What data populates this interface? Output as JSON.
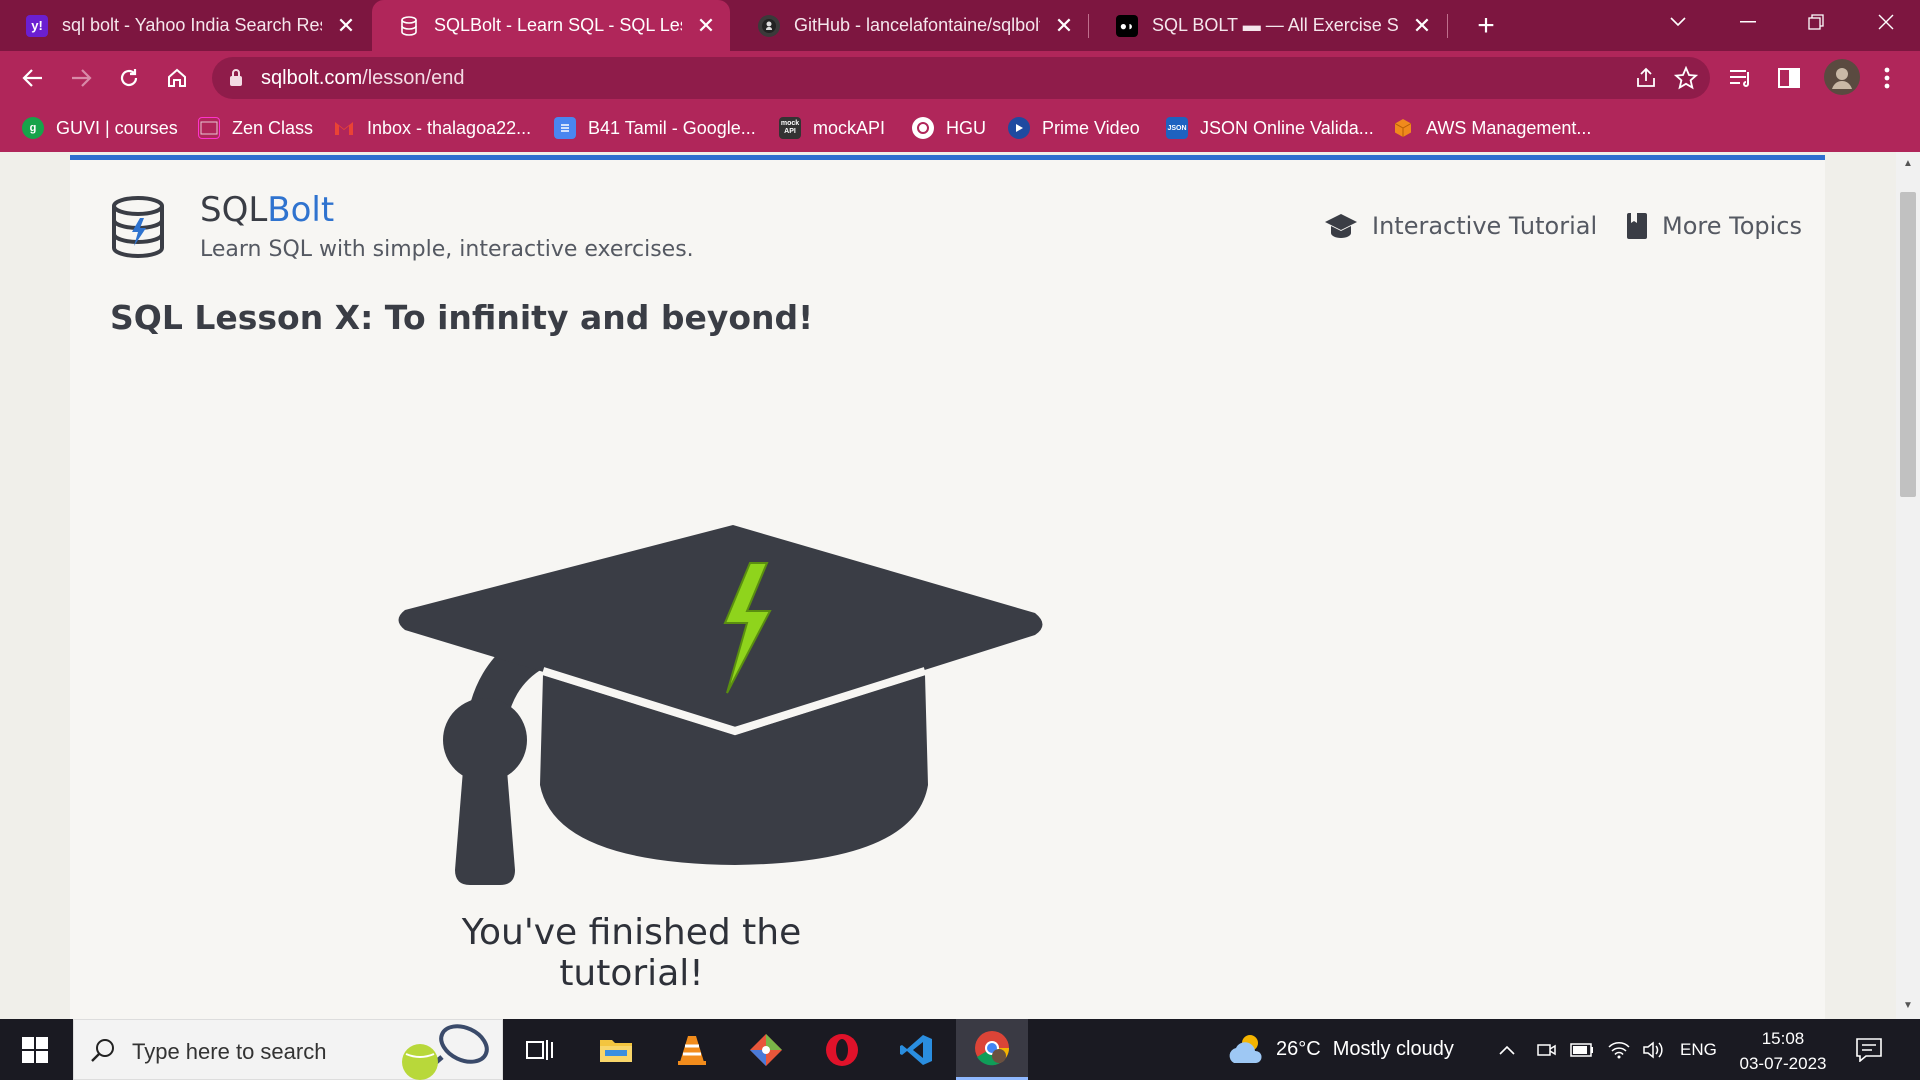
{
  "browser": {
    "tabs": [
      {
        "title": "sql bolt - Yahoo India Search Resu",
        "favicon": "y!",
        "active": false
      },
      {
        "title": "SQLBolt - Learn SQL - SQL Lesson",
        "favicon": "db",
        "active": true
      },
      {
        "title": "GitHub - lancelafontaine/sqlbolt-",
        "favicon": "gh",
        "active": false
      },
      {
        "title": "SQL BOLT ▬ — All Exercise Soluti",
        "favicon": "M",
        "active": false
      }
    ],
    "new_tab_label": "+",
    "address": {
      "host": "sqlbolt.com",
      "path": "/lesson/end"
    },
    "bookmarks": [
      {
        "label": "GUVI | courses",
        "icon": "g"
      },
      {
        "label": "Zen Class",
        "icon": "zen"
      },
      {
        "label": "Inbox - thalagoa22...",
        "icon": "M"
      },
      {
        "label": "B41 Tamil - Google...",
        "icon": "doc"
      },
      {
        "label": "mockAPI",
        "icon": "mock API"
      },
      {
        "label": "HGU",
        "icon": "hgu"
      },
      {
        "label": "Prime Video",
        "icon": "play"
      },
      {
        "label": "JSON Online Valida...",
        "icon": "JSON"
      },
      {
        "label": "AWS Management...",
        "icon": "aws"
      }
    ]
  },
  "site": {
    "brand_prefix": "SQL",
    "brand_suffix": "Bolt",
    "tagline": "Learn SQL with simple, interactive exercises.",
    "nav": {
      "interactive_tutorial": "Interactive Tutorial",
      "more_topics": "More Topics"
    },
    "lesson_title": "SQL Lesson X: To infinity and beyond!",
    "finished_text": "You've finished the tutorial!",
    "colors": {
      "accent": "#2f73cf",
      "cap": "#3a3d45",
      "bolt": "#8fd41c",
      "browser": "#b0265a"
    }
  },
  "taskbar": {
    "search_placeholder": "Type here to search",
    "weather": {
      "temp": "26°C",
      "condition": "Mostly cloudy"
    },
    "language": "ENG",
    "time": "15:08",
    "date": "03-07-2023"
  }
}
